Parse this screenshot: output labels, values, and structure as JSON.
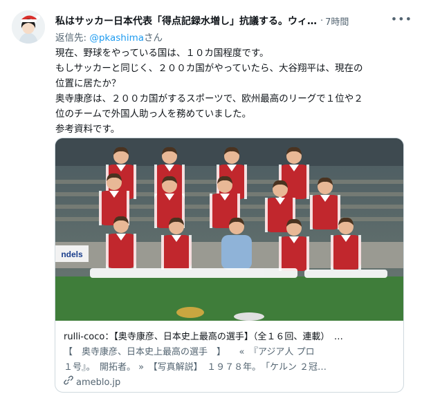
{
  "author": {
    "display_name": "私はサッカー日本代表「得点記録水増し」抗議する。ウィ…",
    "separator": "·",
    "time": "7時間",
    "more_glyph": "•••"
  },
  "reply": {
    "prefix": "返信先: ",
    "handle": "@pkashima",
    "suffix": "さん"
  },
  "body_lines": [
    "現在、野球をやっている国は、１０カ国程度です。",
    "もしサッカーと同じく、２００カ国がやっていたら、大谷翔平は、現在の",
    "位置に居たか？",
    "奥寺康彦は、２００カ国がするスポーツで、欧州最高のリーグで１位や２",
    "位のチームで外国人助っ人を務めていました。",
    "参考資料です。"
  ],
  "photo_banner_text": "ndels",
  "card": {
    "title": "rulli-coco：【奥寺康彦、日本史上最高の選手】（全１６回、連載）　…",
    "desc_line1": "【　奥寺康彦、日本史上最高の選手　】　　«　『アジア人 プロ",
    "desc_line2": "１号』。　開拓者。 »　【写真解説】　１９７８年。　「ケルン ２冠…",
    "domain": "ameblo.jp"
  },
  "icons": {
    "avatar": "user-avatar",
    "link": "link-icon",
    "more": "more-options-icon"
  },
  "colors": {
    "accent": "#1d9bf0",
    "muted": "#536471",
    "border": "#cfd9de",
    "jersey": "#c1272d"
  }
}
